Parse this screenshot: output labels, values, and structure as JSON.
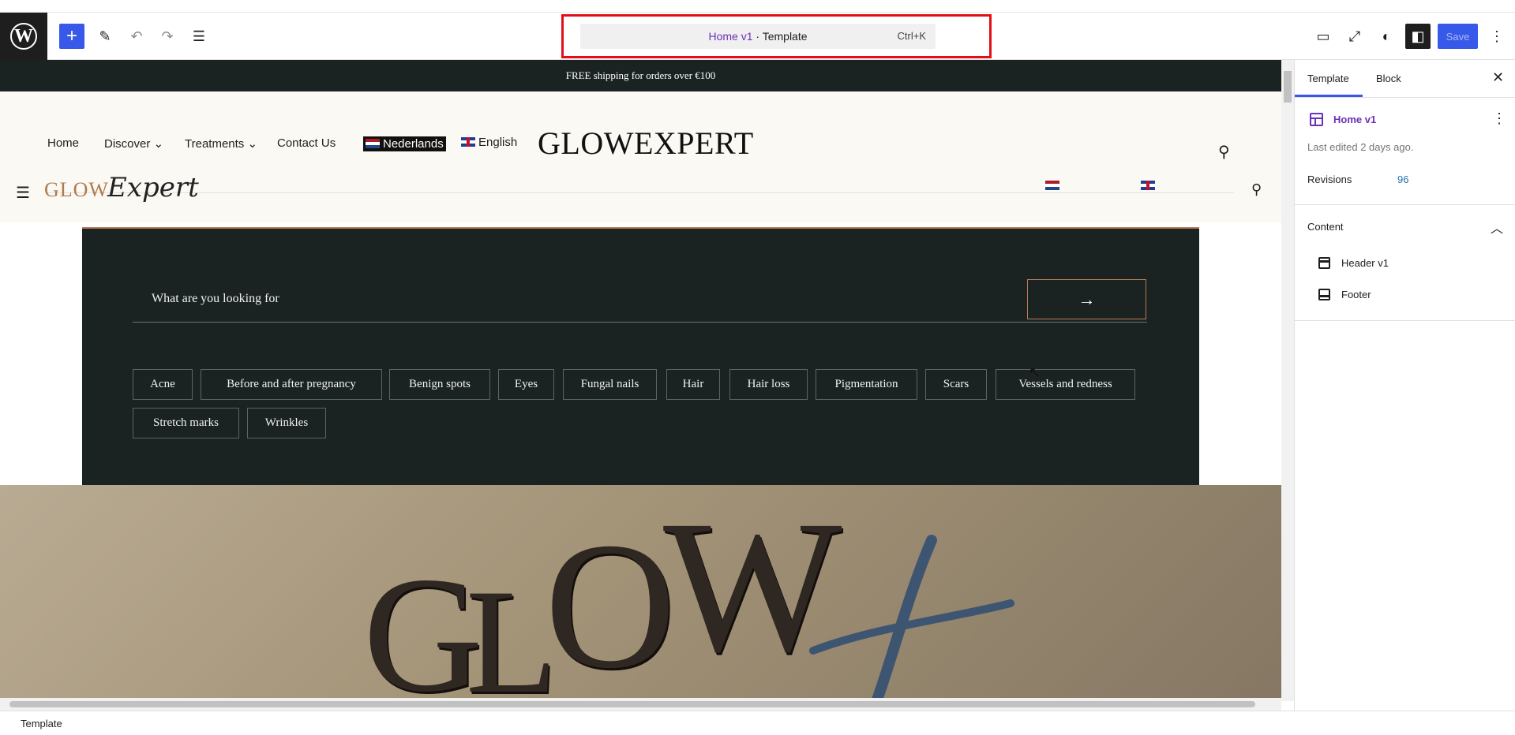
{
  "toolbar": {
    "logo_text": "W",
    "doc_title": "Home v1",
    "doc_type": " · Template",
    "shortcut": "Ctrl+K",
    "save_label": "Save"
  },
  "site": {
    "shipping": "FREE shipping for orders over €100",
    "nav": [
      "Home",
      "Discover",
      "Treatments",
      "Contact Us"
    ],
    "lang_nl": "Nederlands",
    "lang_en": "English",
    "brand": "GLOWEXPERT",
    "brand_glow": "GLOW",
    "brand_expert": "Expert",
    "search_placeholder": "What are you looking for",
    "search_arrow": "→",
    "tags": [
      "Acne",
      "Before and after pregnancy",
      "Benign spots",
      "Eyes",
      "Fungal nails",
      "Hair",
      "Hair loss",
      "Pigmentation",
      "Scars",
      "Vessels and redness",
      "Stretch marks",
      "Wrinkles"
    ]
  },
  "sidebar": {
    "tab_template": "Template",
    "tab_block": "Block",
    "template_name": "Home v1",
    "last_edited": "Last edited 2 days ago.",
    "revisions_label": "Revisions",
    "revisions_count": "96",
    "content_heading": "Content",
    "content_items": [
      "Header v1",
      "Footer"
    ]
  },
  "footer": {
    "breadcrumb": "Template"
  },
  "colors": {
    "accent": "#3858e9",
    "template_purple": "#6b2fba",
    "site_dark": "#1b2322",
    "site_cream": "#fbf9f4",
    "highlight_red": "#e10f18"
  }
}
